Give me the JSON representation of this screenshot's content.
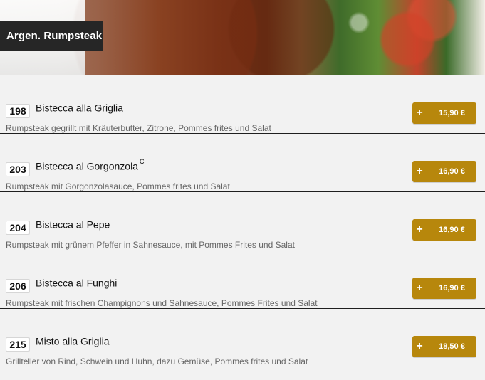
{
  "category": {
    "title": "Argen. Rumpsteak"
  },
  "items": [
    {
      "number": "198",
      "name": "Bistecca alla Griglia",
      "superscript": "",
      "description": "Rumpsteak gegrillt mit Kräuterbutter, Zitrone, Pommes frites und Salat",
      "add": "+",
      "price": "15,90 €"
    },
    {
      "number": "203",
      "name": "Bistecca al Gorgonzola",
      "superscript": "C",
      "description": "Rumpsteak mit Gorgonzolasauce, Pommes frites und Salat",
      "add": "+",
      "price": "16,90 €"
    },
    {
      "number": "204",
      "name": "Bistecca al Pepe",
      "superscript": "",
      "description": "Rumpsteak mit grünem Pfeffer in Sahnesauce, mit Pommes Frites und Salat",
      "add": "+",
      "price": "16,90 €"
    },
    {
      "number": "206",
      "name": "Bistecca al Funghi",
      "superscript": "",
      "description": "Rumpsteak mit frischen Champignons und Sahnesauce, Pommes Frites und Salat",
      "add": "+",
      "price": "16,90 €"
    },
    {
      "number": "215",
      "name": "Misto alla Griglia",
      "superscript": "",
      "description": "Grillteller von Rind, Schwein und Huhn, dazu Gemüse, Pommes frites und Salat",
      "add": "+",
      "price": "18,50 €"
    }
  ],
  "colors": {
    "accent": "#b7870c",
    "dark_tab": "#262626",
    "row_bg": "#f2f2f2"
  }
}
